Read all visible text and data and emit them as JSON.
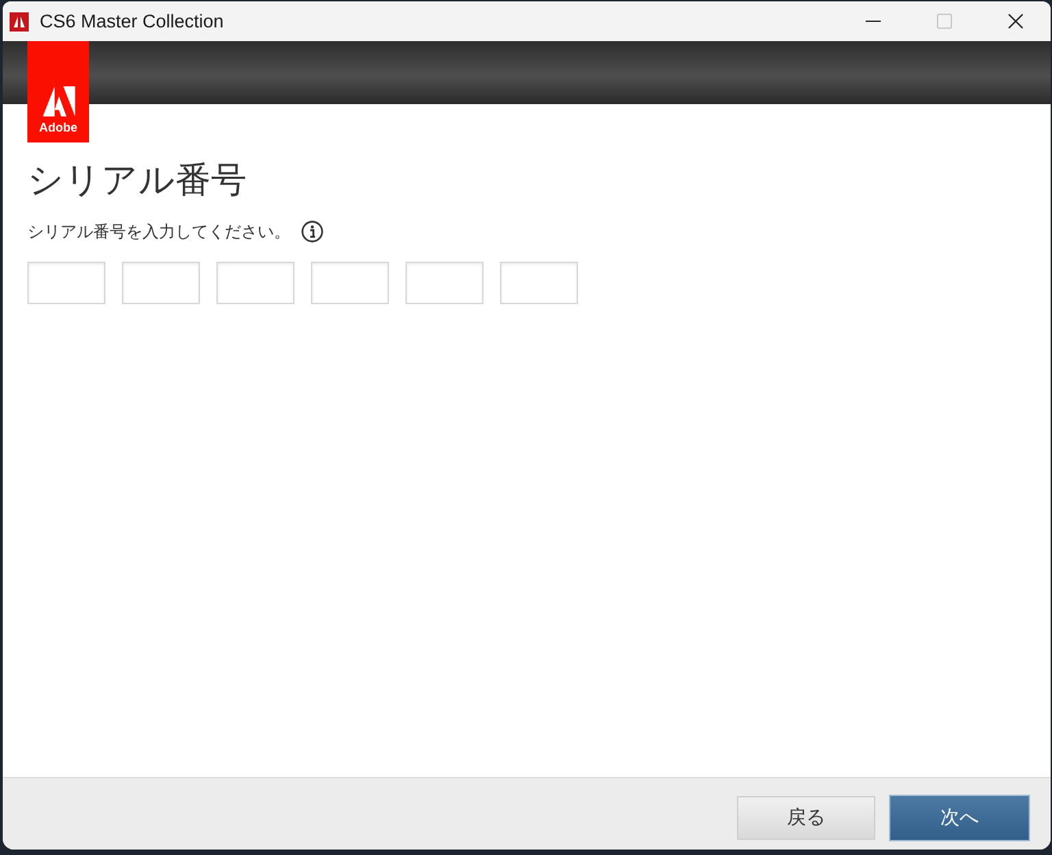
{
  "window": {
    "title": "CS6 Master Collection",
    "controls": [
      {
        "kind": "minimize",
        "disabled": false
      },
      {
        "kind": "maximize",
        "disabled": true
      },
      {
        "kind": "close",
        "disabled": false
      }
    ]
  },
  "logo": {
    "text": "Adobe"
  },
  "heading": "シリアル番号",
  "instruction": "シリアル番号を入力してください。",
  "serial_fields": [
    {
      "kind": "input"
    },
    {
      "kind": "input"
    },
    {
      "kind": "input"
    },
    {
      "kind": "input"
    },
    {
      "kind": "input"
    },
    {
      "kind": "input"
    }
  ],
  "buttons": [
    {
      "label": "戻る",
      "kind": "secondary"
    },
    {
      "label": "次へ",
      "kind": "primary"
    }
  ]
}
